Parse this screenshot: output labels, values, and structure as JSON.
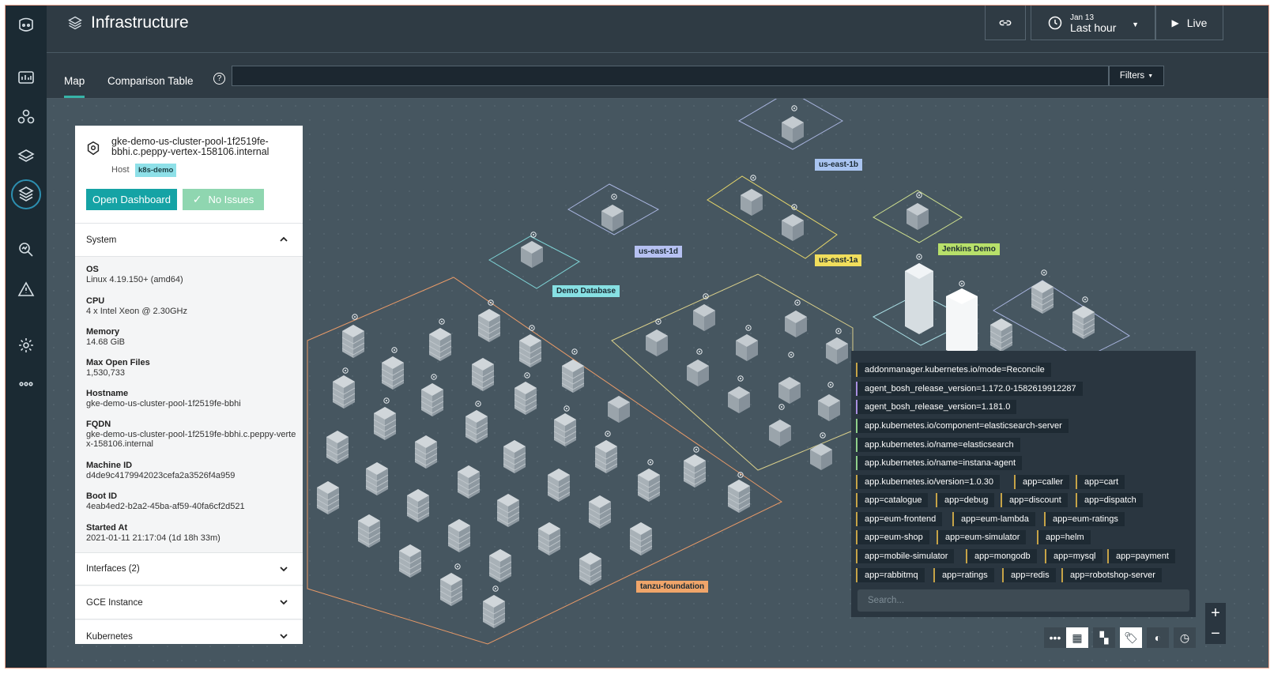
{
  "topbar": {
    "title": "Infrastructure",
    "date_small": "Jan 13",
    "time_range": "Last hour",
    "live_label": "Live"
  },
  "tabs": {
    "map": "Map",
    "comparison": "Comparison Table",
    "filters": "Filters"
  },
  "zones": {
    "us_east_1b": "us-east-1b",
    "us_east_1d": "us-east-1d",
    "us_east_1a": "us-east-1a",
    "jenkins": "Jenkins Demo",
    "demo_db": "Demo Database",
    "tanzu": "tanzu-foundation"
  },
  "panel": {
    "hostname": "gke-demo-us-cluster-pool-1f2519fe-bbhi.c.peppy-vertex-158106.internal",
    "host_label": "Host",
    "host_badge": "k8s-demo",
    "open_dashboard": "Open Dashboard",
    "no_issues": "No Issues",
    "system_title": "System",
    "props": [
      {
        "k": "OS",
        "v": "Linux 4.19.150+ (amd64)"
      },
      {
        "k": "CPU",
        "v": "4 x Intel Xeon @ 2.30GHz"
      },
      {
        "k": "Memory",
        "v": "14.68 GiB"
      },
      {
        "k": "Max Open Files",
        "v": "1,530,733"
      },
      {
        "k": "Hostname",
        "v": "gke-demo-us-cluster-pool-1f2519fe-bbhi"
      },
      {
        "k": "FQDN",
        "v": "gke-demo-us-cluster-pool-1f2519fe-bbhi.c.peppy-vertex-158106.internal"
      },
      {
        "k": "Machine ID",
        "v": "d4de9c4179942023cefa2a3526f4a959"
      },
      {
        "k": "Boot ID",
        "v": "4eab4ed2-b2a2-45ba-af59-40fa6cf2d521"
      },
      {
        "k": "Started At",
        "v": "2021-01-11 21:17:04 (1d 18h 33m)"
      }
    ],
    "interfaces": "Interfaces (2)",
    "gce": "GCE Instance",
    "kubernetes": "Kubernetes"
  },
  "labels": {
    "items": [
      "addonmanager.kubernetes.io/mode=Reconcile",
      "agent_bosh_release_version=1.172.0-1582619912287",
      "agent_bosh_release_version=1.181.0",
      "app.kubernetes.io/component=elasticsearch-server",
      "app.kubernetes.io/name=elasticsearch",
      "app.kubernetes.io/name=instana-agent",
      "app.kubernetes.io/version=1.0.30",
      "app=caller",
      "app=cart",
      "app=catalogue",
      "app=debug",
      "app=discount",
      "app=dispatch",
      "app=eum-frontend",
      "app=eum-lambda",
      "app=eum-ratings",
      "app=eum-shop",
      "app=eum-simulator",
      "app=helm",
      "app=mobile-simulator",
      "app=mongodb",
      "app=mysql",
      "app=payment",
      "app=rabbitmq",
      "app=ratings",
      "app=redis",
      "app=robotshop-server"
    ],
    "search_placeholder": "Search..."
  }
}
